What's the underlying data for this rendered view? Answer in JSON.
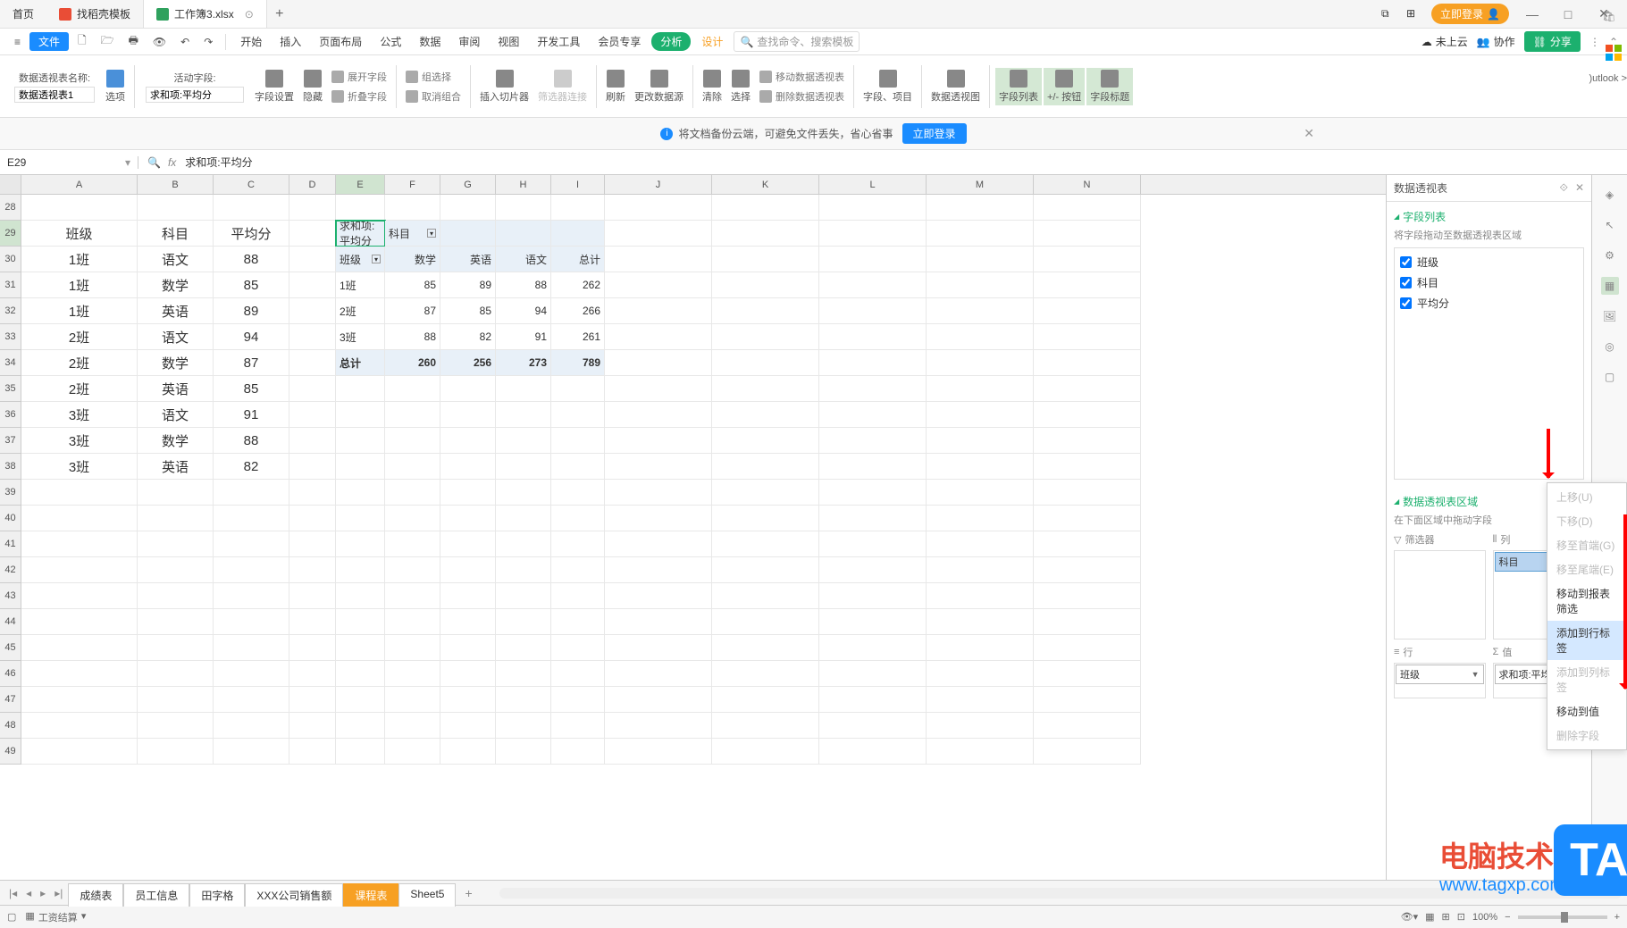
{
  "titlebar": {
    "home": "首页",
    "tabs": [
      {
        "label": "找稻壳模板",
        "type": "pdf"
      },
      {
        "label": "工作簿3.xlsx",
        "type": "xls",
        "active": true
      }
    ],
    "login": "立即登录",
    "icons": {
      "dock": "⧉",
      "grid": "⊞",
      "min": "—",
      "max": "□",
      "close": "✕",
      "cart": "🛍"
    }
  },
  "menubar": {
    "file": "文件",
    "quick": [
      "新建",
      "打开",
      "保存",
      "打印",
      "撤销",
      "重做"
    ],
    "tabs": [
      "开始",
      "插入",
      "页面布局",
      "公式",
      "数据",
      "审阅",
      "视图",
      "开发工具",
      "会员专享"
    ],
    "analysis": "分析",
    "design": "设计",
    "search_ph": "查找命令、搜索模板",
    "cloud": "未上云",
    "collab": "协作",
    "share": "分享"
  },
  "ribbon": {
    "pivot_name_label": "数据透视表名称:",
    "pivot_name_value": "数据透视表1",
    "options": "选项",
    "active_field_label": "活动字段:",
    "active_field_value": "求和项:平均分",
    "field_settings": "字段设置",
    "hide": "隐藏",
    "expand_field": "展开字段",
    "collapse_field": "折叠字段",
    "group_sel": "组选择",
    "ungroup": "取消组合",
    "insert_slicer": "插入切片器",
    "filter_conn": "筛选器连接",
    "refresh": "刷新",
    "change_source": "更改数据源",
    "clear": "清除",
    "select": "选择",
    "move_pivot": "移动数据透视表",
    "delete_pivot": "删除数据透视表",
    "fields_items": "字段、项目",
    "pivot_chart": "数据透视图",
    "field_list": "字段列表",
    "plusminus": "+/- 按钮",
    "field_headers": "字段标题"
  },
  "banner": {
    "text": "将文档备份云端，可避免文件丢失，省心省事",
    "btn": "立即登录"
  },
  "formula": {
    "cell": "E29",
    "value": "求和项:平均分"
  },
  "columns": [
    "A",
    "B",
    "C",
    "D",
    "E",
    "F",
    "G",
    "H",
    "I",
    "J",
    "K",
    "L",
    "M",
    "N"
  ],
  "row_start": 28,
  "row_end": 49,
  "source_headers": {
    "class": "班级",
    "subject": "科目",
    "avg": "平均分"
  },
  "source_data": [
    {
      "class": "1班",
      "subject": "语文",
      "avg": "88"
    },
    {
      "class": "1班",
      "subject": "数学",
      "avg": "85"
    },
    {
      "class": "1班",
      "subject": "英语",
      "avg": "89"
    },
    {
      "class": "2班",
      "subject": "语文",
      "avg": "94"
    },
    {
      "class": "2班",
      "subject": "数学",
      "avg": "87"
    },
    {
      "class": "2班",
      "subject": "英语",
      "avg": "85"
    },
    {
      "class": "3班",
      "subject": "语文",
      "avg": "91"
    },
    {
      "class": "3班",
      "subject": "数学",
      "avg": "88"
    },
    {
      "class": "3班",
      "subject": "英语",
      "avg": "82"
    }
  ],
  "pivot": {
    "corner": "求和项:平均分",
    "col_label": "科目",
    "row_label": "班级",
    "cols": [
      "数学",
      "英语",
      "语文",
      "总计"
    ],
    "rows": [
      {
        "label": "1班",
        "vals": [
          "85",
          "89",
          "88",
          "262"
        ]
      },
      {
        "label": "2班",
        "vals": [
          "87",
          "85",
          "94",
          "266"
        ]
      },
      {
        "label": "3班",
        "vals": [
          "88",
          "82",
          "91",
          "261"
        ]
      }
    ],
    "total_label": "总计",
    "totals": [
      "260",
      "256",
      "273",
      "789"
    ]
  },
  "rightpanel": {
    "title": "数据透视表",
    "field_list_title": "字段列表",
    "field_list_sub": "将字段拖动至数据透视表区域",
    "fields": [
      {
        "name": "班级",
        "checked": true
      },
      {
        "name": "科目",
        "checked": true
      },
      {
        "name": "平均分",
        "checked": true
      }
    ],
    "areas_title": "数据透视表区域",
    "areas_sub": "在下面区域中拖动字段",
    "filter_label": "筛选器",
    "col_label": "列",
    "row_label": "行",
    "val_label": "值",
    "col_items": [
      "科目"
    ],
    "row_items": [
      "班级"
    ],
    "val_items": [
      "求和项:平均分"
    ]
  },
  "context_menu": [
    {
      "label": "上移(U)",
      "disabled": true
    },
    {
      "label": "下移(D)",
      "disabled": true
    },
    {
      "label": "移至首端(G)",
      "disabled": true
    },
    {
      "label": "移至尾端(E)",
      "disabled": true
    },
    {
      "label": "移动到报表筛选",
      "disabled": false
    },
    {
      "label": "添加到行标签",
      "disabled": false,
      "highlighted": true
    },
    {
      "label": "添加到列标签",
      "disabled": true
    },
    {
      "label": "移动到值",
      "disabled": false
    },
    {
      "label": "删除字段",
      "disabled": true
    }
  ],
  "sheets": {
    "tabs": [
      "成绩表",
      "员工信息",
      "田字格",
      "XXX公司销售额",
      "课程表",
      "Sheet5"
    ],
    "active_index": 4
  },
  "statusbar": {
    "salary": "工资结算",
    "zoom": "100%"
  },
  "watermark": {
    "line1": "电脑技术网",
    "line2": "www.tagxp.com",
    "tag": "TAG"
  },
  "outlook_label": ")utlook >"
}
